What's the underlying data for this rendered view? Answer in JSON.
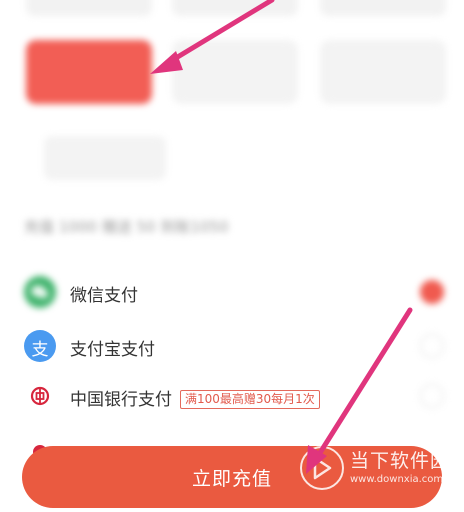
{
  "amounts": {
    "top_row": [
      "",
      "",
      ""
    ],
    "row": [
      "",
      "",
      ""
    ],
    "custom": ""
  },
  "summary": "充值 1000 赠送 50 到账1050",
  "payment_methods": [
    {
      "label": "微信支付",
      "icon": "wechat-pay-icon",
      "color": "#3fb36c",
      "selected": true,
      "promo": ""
    },
    {
      "label": "支付宝支付",
      "icon": "alipay-icon",
      "glyph": "支",
      "color": "#4a9af0",
      "selected": false,
      "promo": ""
    },
    {
      "label": "中国银行支付",
      "icon": "bank-of-china-icon",
      "color": "#d7263d",
      "selected": false,
      "promo": "满100最高赠30每月1次"
    },
    {
      "label": "",
      "icon": "bank-icon",
      "color": "#d7263d",
      "selected": false,
      "promo": ""
    }
  ],
  "recharge_button": "立即充值",
  "watermark": {
    "text": "当下软件园",
    "url": "www.downxia.com"
  },
  "colors": {
    "accent": "#f25e55",
    "button": "#ea5a40",
    "arrow": "#e0357d"
  }
}
